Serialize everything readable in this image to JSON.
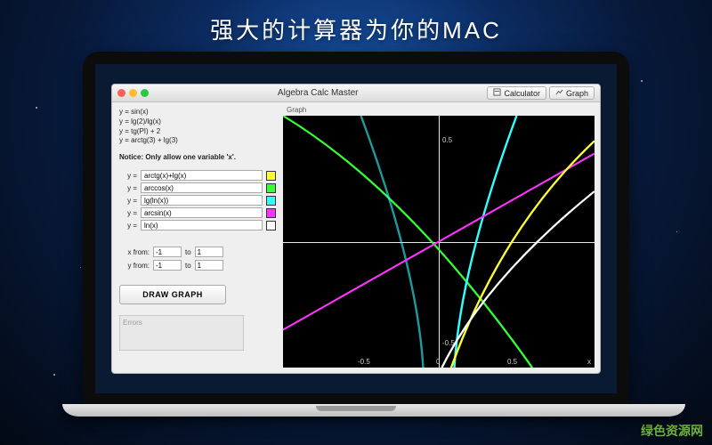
{
  "headline": "强大的计算器为你的MAC",
  "watermark": "绿色资源网",
  "window": {
    "title": "Algebra Calc Master",
    "tabs": {
      "calculator": "Calculator",
      "graph": "Graph"
    },
    "examples": [
      "y = sin(x)",
      "y = lg(2)/lg(x)",
      "y = tg(PI) + 2",
      "y = arctg(3) + lg(3)"
    ],
    "notice": "Notice: Only allow one variable 'x'.",
    "fn_label": "y  =",
    "functions": [
      {
        "expr": "arctg(x)+lg(x)",
        "color": "#ffff33"
      },
      {
        "expr": "arccos(x)",
        "color": "#33ff33"
      },
      {
        "expr": "lg(ln(x))",
        "color": "#33ffff"
      },
      {
        "expr": "arcsin(x)",
        "color": "#ff33ff"
      },
      {
        "expr": "ln(x)",
        "color": "#ffffff"
      }
    ],
    "range": {
      "x_from_label": "x from:",
      "x_to_label": "to",
      "x_from": "-1",
      "x_to": "1",
      "y_from_label": "y from:",
      "y_to_label": "to",
      "y_from": "-1",
      "y_to": "1"
    },
    "draw_button": "DRAW GRAPH",
    "errors_placeholder": "Errors",
    "graph_panel_label": "Graph",
    "ticks": {
      "xneg": "-0.5",
      "xzero": "0",
      "xpos": "0.5",
      "yneg": "-0.5",
      "ypos": "0.5",
      "xaxis_label": "x"
    }
  },
  "chart_data": {
    "type": "line",
    "xlim": [
      -1,
      1
    ],
    "ylim": [
      -1,
      1
    ],
    "x": [
      -1,
      -0.5,
      0,
      0.5,
      1
    ],
    "series": [
      {
        "name": "arctg(x)+lg(x)",
        "color": "#ffff33"
      },
      {
        "name": "arccos(x)",
        "color": "#33ff33"
      },
      {
        "name": "lg(ln(x))",
        "color": "#33ffff"
      },
      {
        "name": "arcsin(x)",
        "color": "#ff33ff"
      },
      {
        "name": "ln(x)",
        "color": "#ffffff"
      }
    ]
  }
}
